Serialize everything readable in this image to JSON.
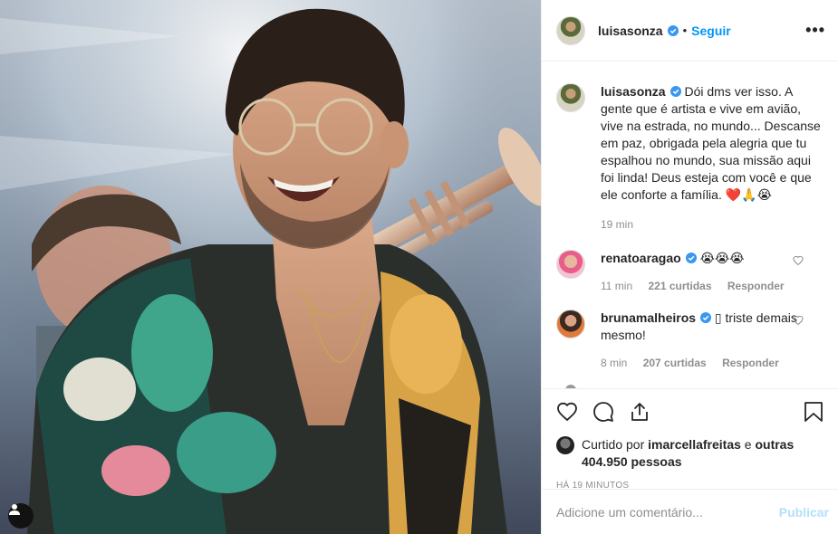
{
  "post": {
    "author": "luisasonza",
    "follow_label": "Seguir",
    "separator": "•",
    "more_label": "•••"
  },
  "caption": {
    "author": "luisasonza",
    "text": "Dói dms ver isso. A gente que é artista e vive em avião, vive na estrada, no mundo... Descanse em paz, obrigada pela alegria que tu espalhou no mundo, sua missão aqui foi linda! Deus esteja com você e que ele conforte a família. ❤️🙏😭",
    "time": "19 min"
  },
  "comments": [
    {
      "author": "renatoaragao",
      "text": "😭😭😭",
      "time": "11 min",
      "likes": "221 curtidas",
      "reply": "Responder"
    },
    {
      "author": "brunamalheiros",
      "text": "▯ triste demais mesmo!",
      "time": "8 min",
      "likes": "207 curtidas",
      "reply": "Responder"
    }
  ],
  "likes": {
    "prefix": "Curtido por",
    "user": "imarcellafreitas",
    "middle": "e",
    "others": "outras 404.950 pessoas"
  },
  "timestamp": "HÁ 19 MINUTOS",
  "add_comment": {
    "placeholder": "Adicione um comentário...",
    "post_label": "Publicar"
  },
  "colors": {
    "accent": "#0095f6",
    "publish_disabled": "#b2dffc",
    "muted": "#8e8e8e",
    "heart": "#ed4956"
  }
}
